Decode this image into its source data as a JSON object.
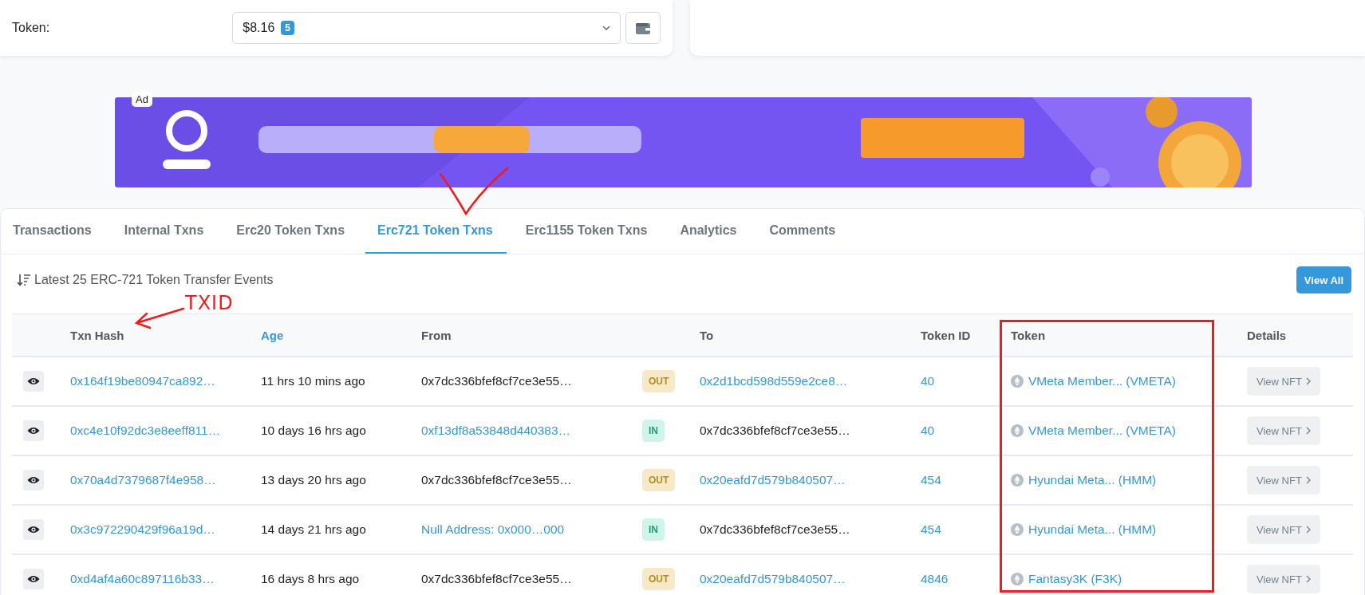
{
  "overview": {
    "token_label": "Token:",
    "token_value": "$8.16",
    "token_count": "5"
  },
  "ad": {
    "badge": "Ad",
    "kind": "picture"
  },
  "tabs": [
    {
      "label": "Transactions",
      "selected": false
    },
    {
      "label": "Internal Txns",
      "selected": false
    },
    {
      "label": "Erc20 Token Txns",
      "selected": false
    },
    {
      "label": "Erc721 Token Txns",
      "selected": true
    },
    {
      "label": "Erc1155 Token Txns",
      "selected": false
    },
    {
      "label": "Analytics",
      "selected": false
    },
    {
      "label": "Comments",
      "selected": false
    }
  ],
  "summary": "Latest 25 ERC-721 Token Transfer Events",
  "view_all": "View All",
  "table": {
    "columns": [
      {
        "label": "Txn Hash",
        "link": false
      },
      {
        "label": "Age",
        "link": true
      },
      {
        "label": "From",
        "link": false
      },
      {
        "label": "To",
        "link": false
      },
      {
        "label": "Token ID",
        "link": false
      },
      {
        "label": "Token",
        "link": false
      },
      {
        "label": "Details",
        "link": false
      }
    ],
    "rows": [
      {
        "hash": "0x164f19be80947ca892…",
        "age": "11 hrs 10 mins ago",
        "from": "0x7dc336bfef8cf7ce3e55…",
        "from_link": false,
        "direction": "OUT",
        "to": "0x2d1bcd598d559e2ce8…",
        "to_link": true,
        "token_id": "40",
        "token": "VMeta Member... (VMETA)",
        "details": "View NFT"
      },
      {
        "hash": "0xc4e10f92dc3e8eeff811…",
        "age": "10 days 16 hrs ago",
        "from": "0xf13df8a53848d440383…",
        "from_link": true,
        "direction": "IN",
        "to": "0x7dc336bfef8cf7ce3e55…",
        "to_link": false,
        "token_id": "40",
        "token": "VMeta Member... (VMETA)",
        "details": "View NFT"
      },
      {
        "hash": "0x70a4d7379687f4e958…",
        "age": "13 days 20 hrs ago",
        "from": "0x7dc336bfef8cf7ce3e55…",
        "from_link": false,
        "direction": "OUT",
        "to": "0x20eafd7d579b840507…",
        "to_link": true,
        "token_id": "454",
        "token": "Hyundai Meta... (HMM)",
        "details": "View NFT"
      },
      {
        "hash": "0x3c972290429f96a19d…",
        "age": "14 days 21 hrs ago",
        "from": "Null Address: 0x000…000",
        "from_link": true,
        "direction": "IN",
        "to": "0x7dc336bfef8cf7ce3e55…",
        "to_link": false,
        "token_id": "454",
        "token": "Hyundai Meta... (HMM)",
        "details": "View NFT"
      },
      {
        "hash": "0xd4af4a60c897116b33…",
        "age": "16 days 8 hrs ago",
        "from": "0x7dc336bfef8cf7ce3e55…",
        "from_link": false,
        "direction": "OUT",
        "to": "0x20eafd7d579b840507…",
        "to_link": true,
        "token_id": "4846",
        "token": "Fantasy3K (F3K)",
        "details": "View NFT"
      }
    ]
  },
  "annotations": [
    {
      "kind": "check"
    },
    {
      "kind": "label",
      "text": "TXID"
    },
    {
      "kind": "arrow"
    },
    {
      "kind": "frame"
    }
  ]
}
